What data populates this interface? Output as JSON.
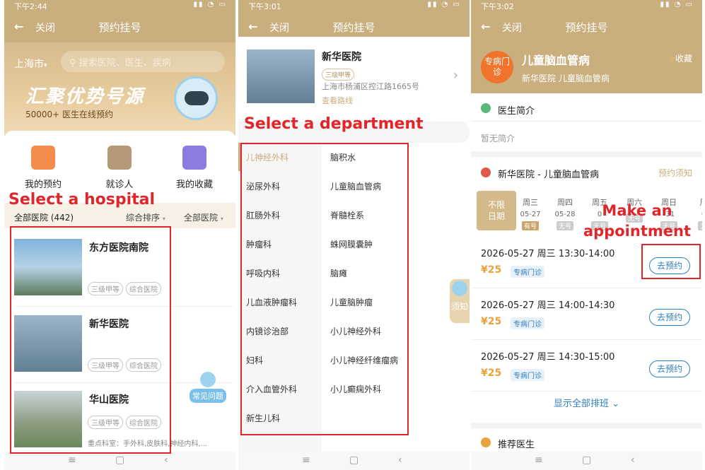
{
  "colors": {
    "header": "#c9ae7e",
    "accent": "#e8a33c",
    "blue": "#2e7fc0",
    "annotation": "#e0262a"
  },
  "p1": {
    "time": "下午2:44",
    "close": "关闭",
    "title": "预约挂号",
    "city": "上海市",
    "search_placeholder": "搜索医院、医生、疾病",
    "slogan": "汇聚优势号源",
    "slogan_sub": "50000+ 医生在线预约",
    "quick": [
      "我的预约",
      "就诊人",
      "我的收藏"
    ],
    "annotation": "Select a hospital",
    "filter": {
      "all": "全部医院 (442)",
      "sort": "综合排序",
      "type": "全部医院"
    },
    "hospitals": [
      {
        "name": "东方医院南院",
        "tags": [
          "三级甲等",
          "综合医院"
        ]
      },
      {
        "name": "新华医院",
        "tags": [
          "三级甲等",
          "综合医院"
        ]
      },
      {
        "name": "华山医院",
        "tags": [
          "三级甲等",
          "综合医院"
        ],
        "depts": "重点科室：手外科,皮肤科,神经内科,..."
      }
    ],
    "faq": "常见问题"
  },
  "p2": {
    "time": "下午3:01",
    "close": "关闭",
    "title": "预约挂号",
    "hospital": {
      "name": "新华医院",
      "tag": "三级甲等",
      "address": "上海市杨浦区控江路1665号",
      "route": "查看路线"
    },
    "annotation": "Select a department",
    "left": [
      "儿神经外科",
      "泌尿外科",
      "肛肠外科",
      "肿瘤科",
      "呼吸内科",
      "儿血液肿瘤科",
      "内镜诊治部",
      "妇科",
      "介入血管外科",
      "新生儿科"
    ],
    "right": [
      "脑积水",
      "儿童脑血管病",
      "脊髓栓系",
      "蛛网膜囊肿",
      "脑瘫",
      "儿童脑肿瘤",
      "小儿神经外科",
      "小儿神经纤维瘤病",
      "小儿癫痫外科"
    ],
    "notice": "须知"
  },
  "p3": {
    "time": "下午3:02",
    "close": "关闭",
    "title": "预约挂号",
    "badge": "专病门诊",
    "disease": "儿童脑血管病",
    "fav": "收藏",
    "sub": "新华医院  儿童脑血管病",
    "intro_title": "医生简介",
    "intro": "暂无简介",
    "dept_line": "新华医院 - 儿童脑血管病",
    "notice": "预约须知",
    "unlimited": "不限日期",
    "days": [
      {
        "w": "周三",
        "d": "05-27",
        "s": "有号"
      },
      {
        "w": "周四",
        "d": "05-28",
        "s": "无号"
      },
      {
        "w": "周五",
        "d": "0",
        "s": "无号"
      },
      {
        "w": "周六",
        "d": "",
        "s": "无号"
      },
      {
        "w": "周日",
        "d": "-31",
        "s": "无号"
      },
      {
        "w": "周",
        "d": "0",
        "s": "无"
      }
    ],
    "annotation": "Make an appointment",
    "slots": [
      {
        "time": "2026-05-27 周三 13:30-14:00",
        "price": "¥25",
        "type": "专病门诊",
        "btn": "去预约"
      },
      {
        "time": "2026-05-27 周三 14:00-14:30",
        "price": "¥25",
        "type": "专病门诊",
        "btn": "去预约"
      },
      {
        "time": "2026-05-27 周三 14:30-15:00",
        "price": "¥25",
        "type": "专病门诊",
        "btn": "去预约"
      }
    ],
    "show_all": "显示全部排班",
    "recommend": "推荐医生"
  }
}
